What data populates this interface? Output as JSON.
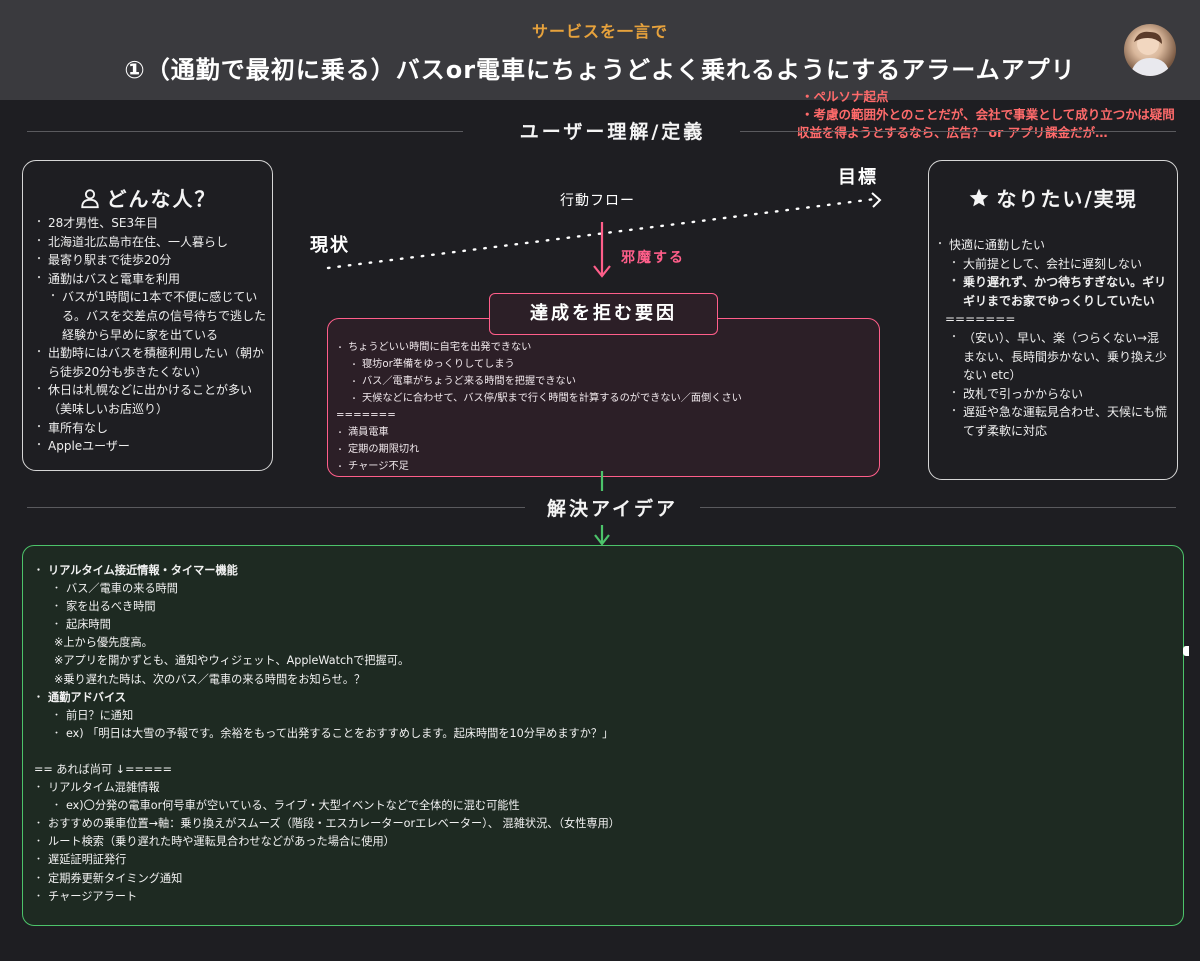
{
  "header": {
    "tagline": "サービスを一言で",
    "title": "①（通勤で最初に乗る）バスor電車にちょうどよく乗れるようにするアラームアプリ"
  },
  "notes": [
    "・ペルソナ起点",
    "・考慮の範囲外とのことだが、会社で事業として成り立つかは疑問",
    "収益を得ようとするなら、広告？ or アプリ課金だが…"
  ],
  "section_user": "ユーザー理解/定義",
  "section_solution": "解決アイデア",
  "persona": {
    "title": "どんな人？",
    "icon": "person-icon",
    "items": [
      {
        "text": "28才男性、SE3年目",
        "level": 0
      },
      {
        "text": "北海道北広島市在住、一人暮らし",
        "level": 0
      },
      {
        "text": "最寄り駅まで徒歩20分",
        "level": 0
      },
      {
        "text": "通勤はバスと電車を利用",
        "level": 0
      },
      {
        "text": "バスが1時間に1本で不便に感じている。バスを交差点の信号待ちで逃した経験から早めに家を出ている",
        "level": 1
      },
      {
        "text": "出勤時にはバスを積極利用したい（朝から徒歩20分も歩きたくない）",
        "level": 0
      },
      {
        "text": "休日は札幌などに出かけることが多い（美味しいお店巡り）",
        "level": 0
      },
      {
        "text": "車所有なし",
        "level": 0
      },
      {
        "text": "Appleユーザー",
        "level": 0
      }
    ]
  },
  "goal": {
    "title": "なりたい/実現",
    "icon": "star-icon",
    "items": [
      {
        "text": "快適に通勤したい",
        "level": 0
      },
      {
        "text": "大前提として、会社に遅刻しない",
        "level": 1
      },
      {
        "text": "乗り遅れず、かつ待ちすぎない。ギリギリまでお家でゆっくりしていたい",
        "level": 1,
        "bold": true
      },
      {
        "text": "=======",
        "level": -1
      },
      {
        "text": "（安い）、早い、楽（つらくない→混まない、長時間歩かない、乗り換え少ない etc）",
        "level": 1
      },
      {
        "text": "改札で引っかからない",
        "level": 1
      },
      {
        "text": "遅延や急な運転見合わせ、天候にも慌てず柔軟に対応",
        "level": 1
      }
    ]
  },
  "flow": {
    "current": "現状",
    "goal": "目標",
    "action_flow": "行動フロー",
    "hindrance": "邪魔する"
  },
  "obstacles": {
    "title": "達成を拒む要因",
    "items": [
      {
        "text": "ちょうどいい時間に自宅を出発できない",
        "level": 0
      },
      {
        "text": "寝坊or準備をゆっくりしてしまう",
        "level": 1
      },
      {
        "text": "バス／電車がちょうど来る時間を把握できない",
        "level": 1
      },
      {
        "text": "天候などに合わせて、バス停/駅まで行く時間を計算するのができない／面倒くさい",
        "level": 1
      },
      {
        "text": "=======",
        "level": -1
      },
      {
        "text": "満員電車",
        "level": 0
      },
      {
        "text": "定期の期限切れ",
        "level": 0
      },
      {
        "text": "チャージ不足",
        "level": 0
      }
    ]
  },
  "ideas": {
    "items": [
      {
        "text": "リアルタイム接近情報・タイマー機能",
        "type": "bold"
      },
      {
        "text": "バス／電車の来る時間",
        "type": "sub"
      },
      {
        "text": "家を出るべき時間",
        "type": "sub"
      },
      {
        "text": "起床時間",
        "type": "sub"
      },
      {
        "text": "※上から優先度高。",
        "type": "note"
      },
      {
        "text": "※アプリを開かずとも、通知やウィジェット、AppleWatchで把握可。",
        "type": "note"
      },
      {
        "text": "※乗り遅れた時は、次のバス／電車の来る時間をお知らせ。？",
        "type": "note"
      },
      {
        "text": "通勤アドバイス",
        "type": "bold"
      },
      {
        "text": "前日？に通知",
        "type": "sub"
      },
      {
        "text": "ex) 「明日は大雪の予報です。余裕をもって出発することをおすすめします。起床時間を10分早めますか？」",
        "type": "sub"
      },
      {
        "text": "",
        "type": "blank"
      },
      {
        "text": "== あれば尚可 ↓=====",
        "type": "plain"
      },
      {
        "text": "リアルタイム混雑情報",
        "type": "item"
      },
      {
        "text": "ex)〇分発の電車or何号車が空いている、ライブ・大型イベントなどで全体的に混む可能性",
        "type": "sub"
      },
      {
        "text": "おすすめの乗車位置→軸：乗り換えがスムーズ（階段・エスカレーターorエレベーター）、 混雑状況、（女性専用）",
        "type": "item"
      },
      {
        "text": "ルート検索（乗り遅れた時や運転見合わせなどがあった場合に使用）",
        "type": "item"
      },
      {
        "text": "遅延証明証発行",
        "type": "item"
      },
      {
        "text": "定期券更新タイミング通知",
        "type": "item"
      },
      {
        "text": "チャージアラート",
        "type": "item"
      }
    ]
  },
  "colors": {
    "accent_orange": "#e7a23c",
    "note_red": "#ff6b6b",
    "pink": "#ff5e8a",
    "green": "#4cc36a",
    "background": "#1e1e22",
    "header": "#3a3a3e"
  }
}
